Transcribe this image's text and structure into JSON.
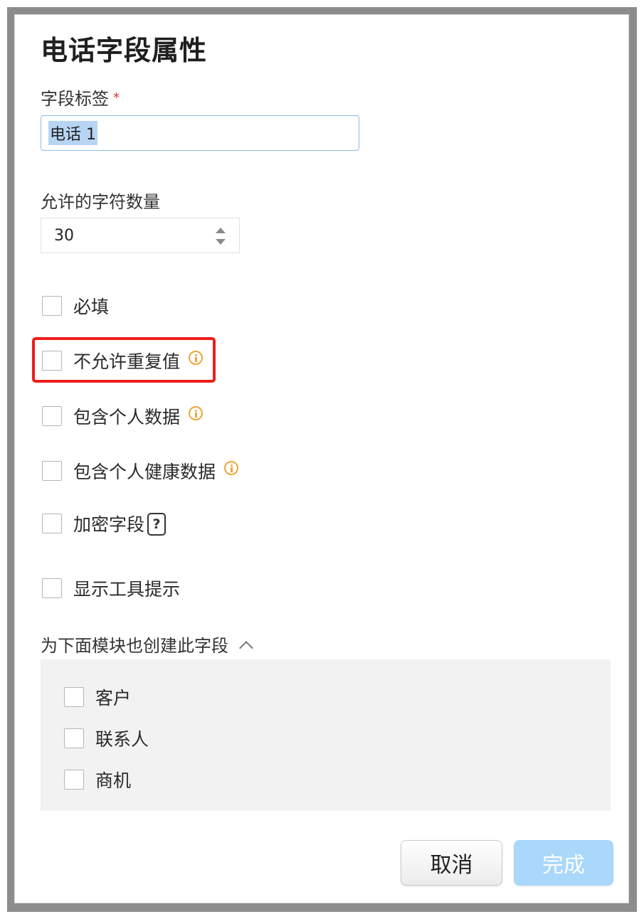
{
  "dialog": {
    "title": "电话字段属性",
    "field_label": {
      "label": "字段标签",
      "required_mark": "*",
      "value": "电话 1"
    },
    "max_chars": {
      "label": "允许的字符数量",
      "value": "30"
    },
    "options": [
      {
        "label": "必填",
        "checked": false,
        "icon": null
      },
      {
        "label": "不允许重复值",
        "checked": false,
        "icon": "info-icon",
        "highlighted": true
      },
      {
        "label": "包含个人数据",
        "checked": false,
        "icon": "info-icon"
      },
      {
        "label": "包含个人健康数据",
        "checked": false,
        "icon": "info-icon"
      },
      {
        "label": "加密字段",
        "checked": false,
        "icon": "help-icon",
        "icon_text": "?"
      },
      {
        "label": "显示工具提示",
        "checked": false,
        "icon": null
      }
    ],
    "modules": {
      "title": "为下面模块也创建此字段",
      "expanded": true,
      "items": [
        {
          "label": "客户",
          "checked": false
        },
        {
          "label": "联系人",
          "checked": false
        },
        {
          "label": "商机",
          "checked": false
        }
      ]
    },
    "buttons": {
      "cancel": "取消",
      "done": "完成"
    }
  },
  "colors": {
    "highlight_border": "#ee1d1d",
    "info_icon": "#f0a53a",
    "done_button_bg": "#a9d8fb",
    "selection_bg": "#b7d5f3"
  }
}
